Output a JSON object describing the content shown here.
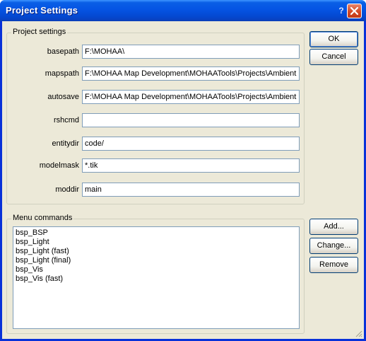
{
  "window": {
    "title": "Project Settings",
    "help_glyph": "?",
    "close_icon": "close-icon",
    "title_color": "#0554e3",
    "close_color": "#d44a25"
  },
  "project_settings": {
    "group_label": "Project settings",
    "fields": {
      "basepath": {
        "label": "basepath",
        "value": "F:\\MOHAA\\"
      },
      "mapspath": {
        "label": "mapspath",
        "value": "F:\\MOHAA Map Development\\MOHAATools\\Projects\\Ambient"
      },
      "autosave": {
        "label": "autosave",
        "value": "F:\\MOHAA Map Development\\MOHAATools\\Projects\\Ambient"
      },
      "rshcmd": {
        "label": "rshcmd",
        "value": ""
      },
      "entitydir": {
        "label": "entitydir",
        "value": "code/"
      },
      "modelmask": {
        "label": "modelmask",
        "value": "*.tik"
      },
      "moddir": {
        "label": "moddir",
        "value": "main"
      }
    }
  },
  "buttons": {
    "ok": "OK",
    "cancel": "Cancel",
    "add": "Add...",
    "change": "Change...",
    "remove": "Remove"
  },
  "menu_commands": {
    "group_label": "Menu commands",
    "items": [
      "bsp_BSP",
      "bsp_Light",
      "bsp_Light (fast)",
      "bsp_Light (final)",
      "bsp_Vis",
      "bsp_Vis (fast)"
    ]
  }
}
